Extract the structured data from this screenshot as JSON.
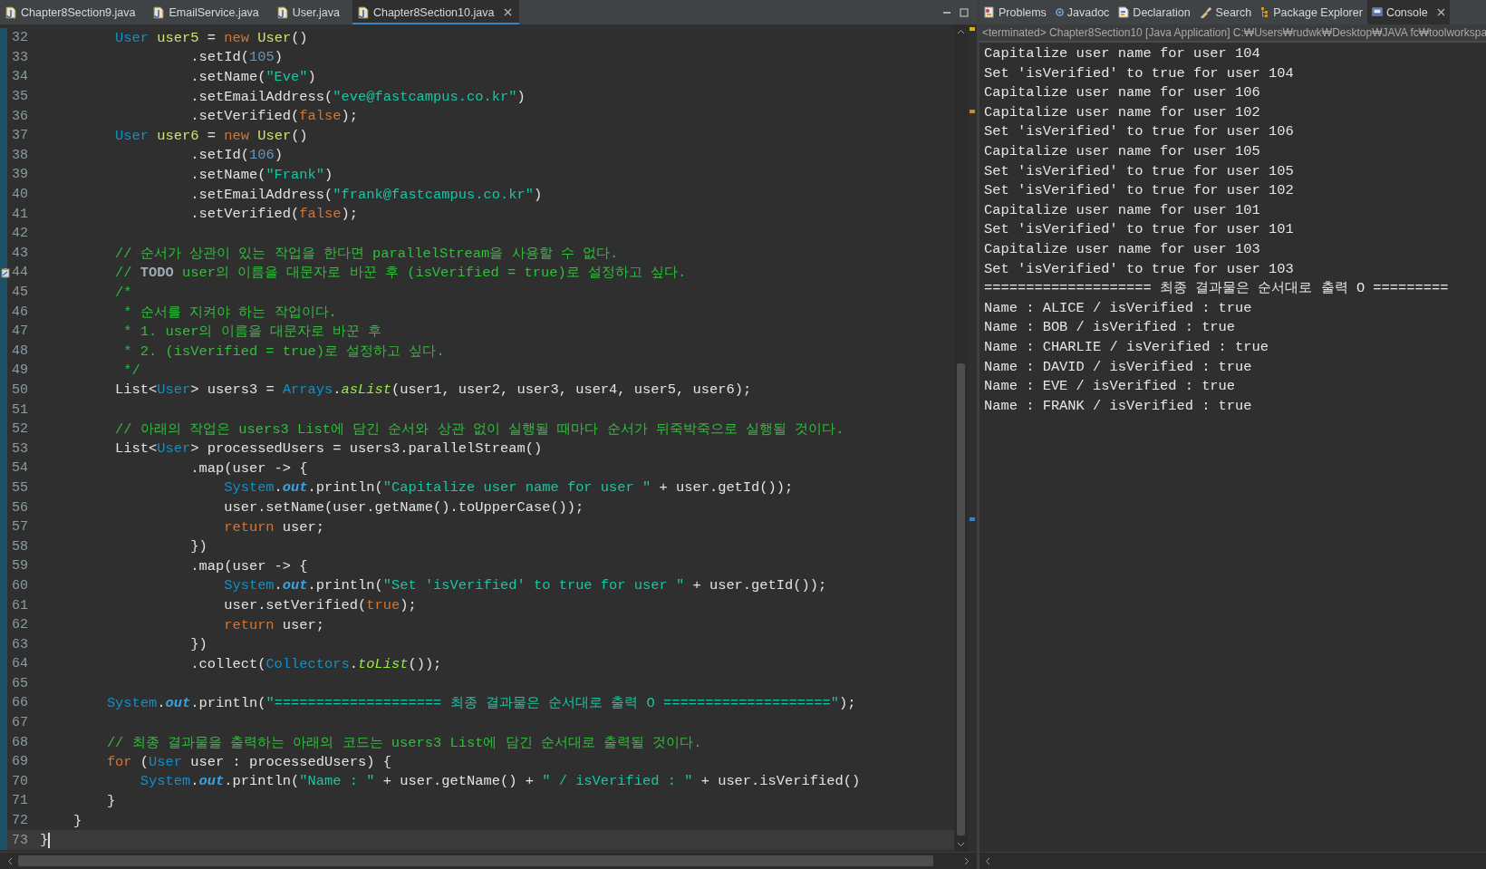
{
  "editor": {
    "tabs": [
      {
        "label": "Chapter8Section9.java",
        "selected": false
      },
      {
        "label": "EmailService.java",
        "selected": false
      },
      {
        "label": "User.java",
        "selected": false
      },
      {
        "label": "Chapter8Section10.java",
        "selected": true
      }
    ],
    "lines": [
      {
        "number": "32",
        "kind": "code",
        "current": false,
        "tokens": [
          {
            "kind": "type",
            "text": "         User "
          },
          {
            "kind": "name",
            "text": "user5"
          },
          {
            "kind": "plain",
            "text": " = "
          },
          {
            "kind": "keyword",
            "text": "new "
          },
          {
            "kind": "name",
            "text": "User"
          },
          {
            "kind": "plain",
            "text": "()"
          }
        ]
      },
      {
        "number": "33",
        "kind": "code",
        "current": false,
        "tokens": [
          {
            "kind": "plain",
            "text": "                  .setId("
          },
          {
            "kind": "number",
            "text": "105"
          },
          {
            "kind": "plain",
            "text": ")"
          }
        ]
      },
      {
        "number": "34",
        "kind": "code",
        "current": false,
        "tokens": [
          {
            "kind": "plain",
            "text": "                  .setName("
          },
          {
            "kind": "string",
            "text": "\"Eve\""
          },
          {
            "kind": "plain",
            "text": ")"
          }
        ]
      },
      {
        "number": "35",
        "kind": "code",
        "current": false,
        "tokens": [
          {
            "kind": "plain",
            "text": "                  .setEmailAddress("
          },
          {
            "kind": "string",
            "text": "\"eve@fastcampus.co.kr\""
          },
          {
            "kind": "plain",
            "text": ")"
          }
        ]
      },
      {
        "number": "36",
        "kind": "code",
        "current": false,
        "tokens": [
          {
            "kind": "plain",
            "text": "                  .setVerified("
          },
          {
            "kind": "keyword",
            "text": "false"
          },
          {
            "kind": "plain",
            "text": ");"
          }
        ]
      },
      {
        "number": "37",
        "kind": "code",
        "current": false,
        "tokens": [
          {
            "kind": "type",
            "text": "         User "
          },
          {
            "kind": "name",
            "text": "user6"
          },
          {
            "kind": "plain",
            "text": " = "
          },
          {
            "kind": "keyword",
            "text": "new "
          },
          {
            "kind": "name",
            "text": "User"
          },
          {
            "kind": "plain",
            "text": "()"
          }
        ]
      },
      {
        "number": "38",
        "kind": "code",
        "current": false,
        "tokens": [
          {
            "kind": "plain",
            "text": "                  .setId("
          },
          {
            "kind": "number",
            "text": "106"
          },
          {
            "kind": "plain",
            "text": ")"
          }
        ]
      },
      {
        "number": "39",
        "kind": "code",
        "current": false,
        "tokens": [
          {
            "kind": "plain",
            "text": "                  .setName("
          },
          {
            "kind": "string",
            "text": "\"Frank\""
          },
          {
            "kind": "plain",
            "text": ")"
          }
        ]
      },
      {
        "number": "40",
        "kind": "code",
        "current": false,
        "tokens": [
          {
            "kind": "plain",
            "text": "                  .setEmailAddress("
          },
          {
            "kind": "string",
            "text": "\"frank@fastcampus.co.kr\""
          },
          {
            "kind": "plain",
            "text": ")"
          }
        ]
      },
      {
        "number": "41",
        "kind": "code",
        "current": false,
        "tokens": [
          {
            "kind": "plain",
            "text": "                  .setVerified("
          },
          {
            "kind": "keyword",
            "text": "false"
          },
          {
            "kind": "plain",
            "text": ");"
          }
        ]
      },
      {
        "number": "42",
        "kind": "code",
        "current": false
      },
      {
        "number": "43",
        "kind": "code",
        "current": false,
        "tokens": [
          {
            "kind": "comment",
            "text": "         // 순서가 상관이 있는 작업을 한다면 parallelStream을 사용할 수 없다."
          }
        ]
      },
      {
        "number": "44",
        "kind": "task",
        "current": false,
        "tokens": [
          {
            "kind": "comment",
            "text": "         // "
          },
          {
            "kind": "task",
            "text": "TODO"
          },
          {
            "kind": "comment",
            "text": " user의 이름을 대문자로 바꾼 후 (isVerified = true)로 설정하고 싶다."
          }
        ]
      },
      {
        "number": "45",
        "kind": "code",
        "current": false,
        "tokens": [
          {
            "kind": "comment",
            "text": "         /*"
          }
        ]
      },
      {
        "number": "46",
        "kind": "code",
        "current": false,
        "tokens": [
          {
            "kind": "comment",
            "text": "          * 순서를 지켜야 하는 작업이다."
          }
        ]
      },
      {
        "number": "47",
        "kind": "code",
        "current": false,
        "tokens": [
          {
            "kind": "comment",
            "text": "          * 1. user의 이름을 대문자로 바꾼 후"
          }
        ]
      },
      {
        "number": "48",
        "kind": "code",
        "current": false,
        "tokens": [
          {
            "kind": "comment",
            "text": "          * 2. (isVerified = true)로 설정하고 싶다."
          }
        ]
      },
      {
        "number": "49",
        "kind": "code",
        "current": false,
        "tokens": [
          {
            "kind": "comment",
            "text": "          */"
          }
        ]
      },
      {
        "number": "50",
        "kind": "code",
        "current": false,
        "tokens": [
          {
            "kind": "plain",
            "text": "         List<"
          },
          {
            "kind": "type",
            "text": "User"
          },
          {
            "kind": "plain",
            "text": "> users3 = "
          },
          {
            "kind": "type",
            "text": "Arrays"
          },
          {
            "kind": "plain",
            "text": "."
          },
          {
            "kind": "static",
            "text": "asList"
          },
          {
            "kind": "plain",
            "text": "(user1, user2, user3, user4, user5, user6);"
          }
        ]
      },
      {
        "number": "51",
        "kind": "code",
        "current": false
      },
      {
        "number": "52",
        "kind": "code",
        "current": false,
        "tokens": [
          {
            "kind": "comment",
            "text": "         // 아래의 작업은 users3 List에 담긴 순서와 상관 없이 실행될 때마다 순서가 뒤죽박죽으로 실행될 것이다."
          }
        ]
      },
      {
        "number": "53",
        "kind": "code",
        "current": false,
        "tokens": [
          {
            "kind": "plain",
            "text": "         List<"
          },
          {
            "kind": "type",
            "text": "User"
          },
          {
            "kind": "plain",
            "text": "> processedUsers = users3.parallelStream()"
          }
        ]
      },
      {
        "number": "54",
        "kind": "code",
        "current": false,
        "tokens": [
          {
            "kind": "plain",
            "text": "                  .map(user -> {"
          }
        ]
      },
      {
        "number": "55",
        "kind": "code",
        "current": false,
        "tokens": [
          {
            "kind": "type",
            "text": "                      System"
          },
          {
            "kind": "plain",
            "text": "."
          },
          {
            "kind": "field",
            "text": "out"
          },
          {
            "kind": "plain",
            "text": ".println("
          },
          {
            "kind": "string",
            "text": "\"Capitalize user name for user \""
          },
          {
            "kind": "plain",
            "text": " + user.getId());"
          }
        ]
      },
      {
        "number": "56",
        "kind": "code",
        "current": false,
        "tokens": [
          {
            "kind": "plain",
            "text": "                      user.setName(user.getName().toUpperCase());"
          }
        ]
      },
      {
        "number": "57",
        "kind": "code",
        "current": false,
        "tokens": [
          {
            "kind": "keyword",
            "text": "                      return"
          },
          {
            "kind": "plain",
            "text": " user;"
          }
        ]
      },
      {
        "number": "58",
        "kind": "code",
        "current": false,
        "tokens": [
          {
            "kind": "plain",
            "text": "                  })"
          }
        ]
      },
      {
        "number": "59",
        "kind": "code",
        "current": false,
        "tokens": [
          {
            "kind": "plain",
            "text": "                  .map(user -> {"
          }
        ]
      },
      {
        "number": "60",
        "kind": "code",
        "current": false,
        "tokens": [
          {
            "kind": "type",
            "text": "                      System"
          },
          {
            "kind": "plain",
            "text": "."
          },
          {
            "kind": "field",
            "text": "out"
          },
          {
            "kind": "plain",
            "text": ".println("
          },
          {
            "kind": "string",
            "text": "\"Set 'isVerified' to true for user \""
          },
          {
            "kind": "plain",
            "text": " + user.getId());"
          }
        ]
      },
      {
        "number": "61",
        "kind": "code",
        "current": false,
        "tokens": [
          {
            "kind": "plain",
            "text": "                      user.setVerified("
          },
          {
            "kind": "keyword",
            "text": "true"
          },
          {
            "kind": "plain",
            "text": ");"
          }
        ]
      },
      {
        "number": "62",
        "kind": "code",
        "current": false,
        "tokens": [
          {
            "kind": "keyword",
            "text": "                      return"
          },
          {
            "kind": "plain",
            "text": " user;"
          }
        ]
      },
      {
        "number": "63",
        "kind": "code",
        "current": false,
        "tokens": [
          {
            "kind": "plain",
            "text": "                  })"
          }
        ]
      },
      {
        "number": "64",
        "kind": "code",
        "current": false,
        "tokens": [
          {
            "kind": "plain",
            "text": "                  .collect("
          },
          {
            "kind": "type",
            "text": "Collectors"
          },
          {
            "kind": "plain",
            "text": "."
          },
          {
            "kind": "static",
            "text": "toList"
          },
          {
            "kind": "plain",
            "text": "());"
          }
        ]
      },
      {
        "number": "65",
        "kind": "code",
        "current": false
      },
      {
        "number": "66",
        "kind": "code",
        "current": false,
        "tokens": [
          {
            "kind": "type",
            "text": "        System"
          },
          {
            "kind": "plain",
            "text": "."
          },
          {
            "kind": "field",
            "text": "out"
          },
          {
            "kind": "plain",
            "text": ".println("
          },
          {
            "kind": "string",
            "text": "\"==================== 최종 결과물은 순서대로 출력 O ====================\""
          },
          {
            "kind": "plain",
            "text": ");"
          }
        ]
      },
      {
        "number": "67",
        "kind": "code",
        "current": false
      },
      {
        "number": "68",
        "kind": "code",
        "current": false,
        "tokens": [
          {
            "kind": "comment",
            "text": "        // 최종 결과물을 출력하는 아래의 코드는 users3 List에 담긴 순서대로 출력될 것이다."
          }
        ]
      },
      {
        "number": "69",
        "kind": "code",
        "current": false,
        "tokens": [
          {
            "kind": "keyword",
            "text": "        for"
          },
          {
            "kind": "plain",
            "text": " ("
          },
          {
            "kind": "type",
            "text": "User"
          },
          {
            "kind": "plain",
            "text": " user : processedUsers) {"
          }
        ]
      },
      {
        "number": "70",
        "kind": "code",
        "current": false,
        "tokens": [
          {
            "kind": "type",
            "text": "            System"
          },
          {
            "kind": "plain",
            "text": "."
          },
          {
            "kind": "field",
            "text": "out"
          },
          {
            "kind": "plain",
            "text": ".println("
          },
          {
            "kind": "string",
            "text": "\"Name : \""
          },
          {
            "kind": "plain",
            "text": " + user.getName() + "
          },
          {
            "kind": "string",
            "text": "\" / isVerified : \""
          },
          {
            "kind": "plain",
            "text": " + user.isVerified()"
          }
        ]
      },
      {
        "number": "71",
        "kind": "code",
        "current": false,
        "tokens": [
          {
            "kind": "plain",
            "text": "        }"
          }
        ]
      },
      {
        "number": "72",
        "kind": "code",
        "current": false,
        "tokens": [
          {
            "kind": "plain",
            "text": "    }"
          }
        ]
      },
      {
        "number": "73",
        "kind": "code",
        "current": true,
        "tokens": [
          {
            "kind": "plain",
            "text": "}"
          }
        ]
      }
    ]
  },
  "console_panel": {
    "tabs": [
      {
        "label": "Problems",
        "kind": "problems",
        "selected": false
      },
      {
        "label": "Javadoc",
        "kind": "javadoc",
        "selected": false
      },
      {
        "label": "Declaration",
        "kind": "declaration",
        "selected": false
      },
      {
        "label": "Search",
        "kind": "search",
        "selected": false
      },
      {
        "label": "Package Explorer",
        "kind": "package",
        "selected": false
      },
      {
        "label": "Console",
        "kind": "console",
        "selected": true
      }
    ],
    "status": "<terminated> Chapter8Section10 [Java Application] C:₩Users₩rudwk₩Desktop₩JAVA fc₩toolworkspa",
    "lines": [
      "Capitalize user name for user 104",
      "Set 'isVerified' to true for user 104",
      "Capitalize user name for user 106",
      "Capitalize user name for user 102",
      "Set 'isVerified' to true for user 106",
      "Capitalize user name for user 105",
      "Set 'isVerified' to true for user 105",
      "Set 'isVerified' to true for user 102",
      "Capitalize user name for user 101",
      "Set 'isVerified' to true for user 101",
      "Capitalize user name for user 103",
      "Set 'isVerified' to true for user 103",
      "==================== 최종 결과물은 순서대로 출력 O =========",
      "Name : ALICE / isVerified : true",
      "Name : BOB / isVerified : true",
      "Name : CHARLIE / isVerified : true",
      "Name : DAVID / isVerified : true",
      "Name : EVE / isVerified : true",
      "Name : FRANK / isVerified : true"
    ]
  }
}
